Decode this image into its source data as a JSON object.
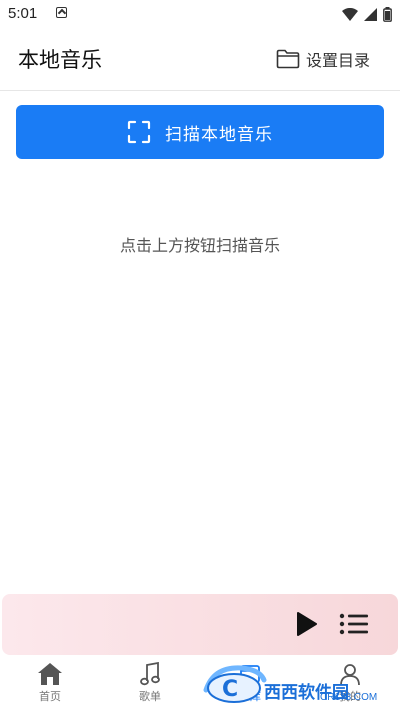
{
  "status_bar": {
    "time": "5:01",
    "icons": [
      "app-notification-icon",
      "wifi-icon",
      "signal-icon",
      "battery-icon"
    ]
  },
  "header": {
    "title": "本地音乐",
    "set_directory_label": "设置目录",
    "set_directory_icon": "folder-icon"
  },
  "scan": {
    "button_label": "扫描本地音乐",
    "icon": "scan-icon",
    "accent_color": "#1a7cf5"
  },
  "empty_state": {
    "hint": "点击上方按钮扫描音乐"
  },
  "player": {
    "play_icon": "play-icon",
    "playlist_icon": "playlist-icon"
  },
  "tabs": [
    {
      "label": "首页",
      "icon": "home-icon"
    },
    {
      "label": "歌单",
      "icon": "music-note-icon"
    },
    {
      "label": "乐库",
      "icon": "library-icon",
      "active": true
    },
    {
      "label": "我的",
      "icon": "profile-icon"
    }
  ],
  "watermark": {
    "text": "西西软件园",
    "subtext": "CR173.COM"
  }
}
